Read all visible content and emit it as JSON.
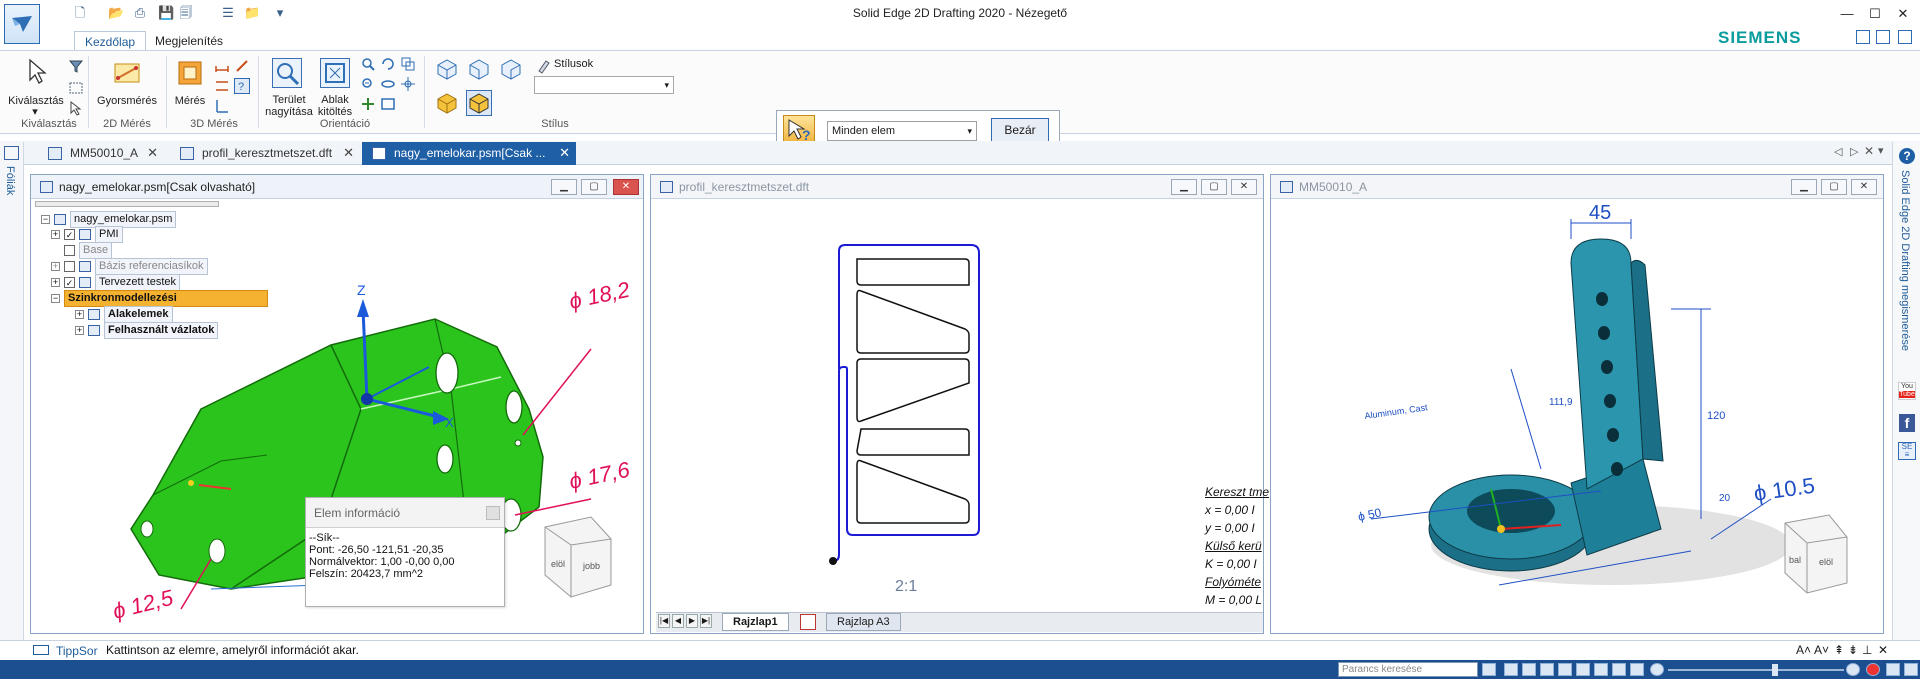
{
  "window": {
    "title": "Solid Edge 2D Drafting 2020 - Nézegető",
    "brand": "SIEMENS"
  },
  "ribbon": {
    "tabs": [
      {
        "label": "Kezdőlap",
        "active": true
      },
      {
        "label": "Megjelenítés",
        "active": false
      }
    ],
    "groups": {
      "select": {
        "label": "Kiválasztás",
        "button": "Kiválasztás"
      },
      "measure2d": {
        "label": "2D Mérés",
        "button": "Gyorsmérés"
      },
      "measure3d": {
        "label": "3D Mérés",
        "button": "Mérés"
      },
      "orientation": {
        "label": "Orientáció",
        "zoom_area": "Terület nagyítása",
        "fit": "Ablak kitöltés"
      },
      "style": {
        "label": "Stílus",
        "styles_label": "Stílusok",
        "style_value": ""
      }
    }
  },
  "command_bar": {
    "filter_value": "Minden elem",
    "close_label": "Bezár"
  },
  "doc_tabs": [
    {
      "label": "MM50010_A",
      "close": "✕",
      "active": false
    },
    {
      "label": "profil_keresztmetszet.dft",
      "close": "✕",
      "active": false
    },
    {
      "label": "nagy_emelokar.psm[Csak ...",
      "close": "✕",
      "active": true
    }
  ],
  "left_rail": {
    "label": "Fóliák"
  },
  "right_rail": {
    "label": "Solid Edge 2D Drafting megismerése"
  },
  "windows": {
    "w1": {
      "title": "nagy_emelokar.psm[Csak olvasható]",
      "tree": [
        {
          "label": "nagy_emelokar.psm"
        },
        {
          "label": "PMI"
        },
        {
          "label": "Base"
        },
        {
          "label": "Bázis referenciasíkok"
        },
        {
          "label": "Tervezett testek"
        },
        {
          "label": "Szinkronmodellezési"
        },
        {
          "label": "Alakelemek"
        },
        {
          "label": "Felhasznált vázlatok"
        }
      ],
      "dimensions": [
        "ϕ 18,2",
        "ϕ 17,6",
        "ϕ 12,5"
      ],
      "axis_labels": {
        "z": "Z",
        "x": "X"
      },
      "viewcube": {
        "left": "elöl",
        "right": "jobb"
      },
      "info": {
        "title": "Elem információ",
        "lines": [
          "--Sík--",
          "Pont: -26,50 -121,51 -20,35",
          "Normálvektor: 1,00 -0,00 0,00",
          "Felszín: 20423,7 mm^2"
        ]
      }
    },
    "w2": {
      "title": "profil_keresztmetszet.dft",
      "scale_label": "2:1",
      "notes": [
        "Kereszt tme",
        "x = 0,00 I",
        "y = 0,00 I",
        "Külső kerü",
        "K = 0,00 I",
        "Folyóméte",
        "M = 0,00 L"
      ],
      "sheets": [
        {
          "label": "Rajzlap1",
          "active": true
        },
        {
          "label": "Rajzlap A3",
          "active": false
        }
      ]
    },
    "w3": {
      "title": "MM50010_A",
      "dimensions": {
        "top": "45",
        "height": "120",
        "d1": "111,9",
        "hole": "ϕ 10.5",
        "base": "ϕ 50",
        "twenty": "20",
        "material": "Aluminum, Cast"
      },
      "viewcube": {
        "left": "bal",
        "right": "elöl"
      }
    }
  },
  "status": {
    "tip_label": "TippSor",
    "tip_text": "Kattintson az elemre, amelyről információt akar.",
    "search_placeholder": "Parancs keresése"
  },
  "colors": {
    "accent": "#1e5fa6",
    "model_green": "#29c21a",
    "model_teal": "#1b6f86",
    "dimension": "#e0105a"
  }
}
